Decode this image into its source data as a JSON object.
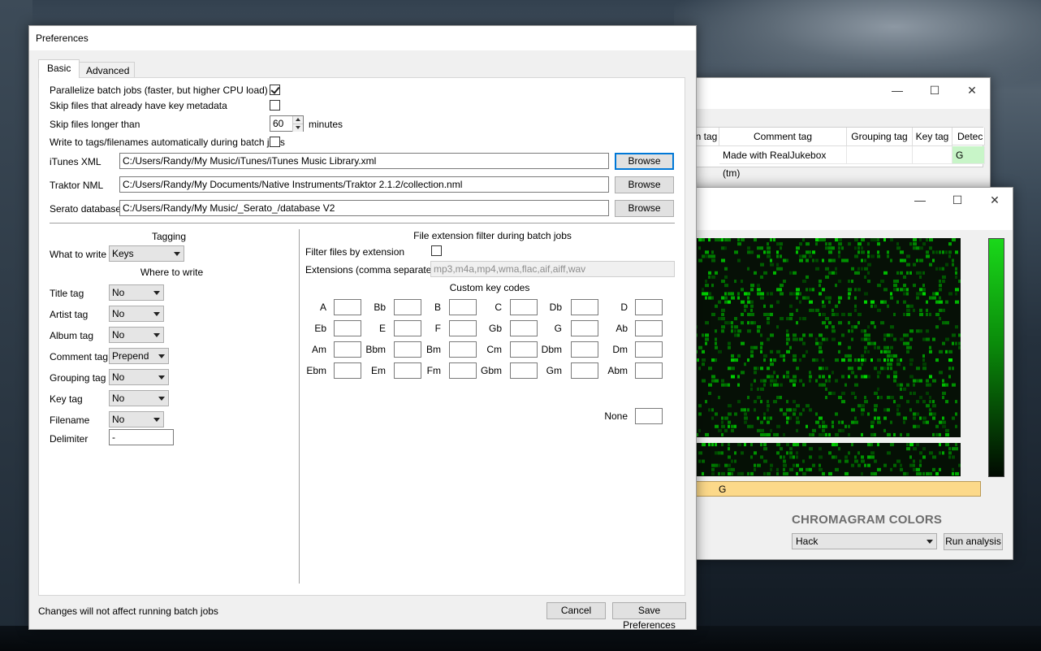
{
  "desktop": {
    "colors": {
      "sky": "#3b4a58",
      "accent": "#0078d7"
    }
  },
  "back_window_1": {
    "columns": [
      "n tag",
      "Comment tag",
      "Grouping tag",
      "Key tag",
      "Detec"
    ],
    "row": {
      "comment": "Made with RealJukebox (tm)",
      "grouping": "",
      "key": "",
      "detected": "G"
    }
  },
  "back_window_2": {
    "key_strip": "G",
    "chromagram_label": "CHROMAGRAM COLORS",
    "color_scheme": "Hack",
    "run_analysis": "Run analysis"
  },
  "prefs": {
    "title": "Preferences",
    "tabs": [
      "Basic",
      "Advanced"
    ],
    "parallelize": {
      "label": "Parallelize batch jobs (faster, but higher CPU load)",
      "checked": true
    },
    "skip_key": {
      "label": "Skip files that already have key metadata",
      "checked": false
    },
    "skip_longer": {
      "label": "Skip files longer than",
      "value": "60",
      "unit": "minutes"
    },
    "write_tags": {
      "label": "Write to tags/filenames automatically during batch jobs",
      "checked": false
    },
    "itunes": {
      "label": "iTunes XML",
      "path": "C:/Users/Randy/My Music/iTunes/iTunes Music Library.xml",
      "button": "Browse"
    },
    "traktor": {
      "label": "Traktor NML",
      "path": "C:/Users/Randy/My Documents/Native Instruments/Traktor 2.1.2/collection.nml",
      "button": "Browse"
    },
    "serato": {
      "label": "Serato database",
      "path": "C:/Users/Randy/My Music/_Serato_/database V2",
      "button": "Browse"
    },
    "tagging": {
      "heading": "Tagging",
      "what_label": "What to write",
      "what_value": "Keys",
      "where_heading": "Where to write",
      "fields": [
        {
          "label": "Title tag",
          "value": "No"
        },
        {
          "label": "Artist tag",
          "value": "No"
        },
        {
          "label": "Album tag",
          "value": "No"
        },
        {
          "label": "Comment tag",
          "value": "Prepend"
        },
        {
          "label": "Grouping tag",
          "value": "No"
        },
        {
          "label": "Key tag",
          "value": "No"
        },
        {
          "label": "Filename",
          "value": "No"
        }
      ],
      "delimiter_label": "Delimiter",
      "delimiter_value": "-"
    },
    "filter": {
      "heading": "File extension filter during batch jobs",
      "by_ext_label": "Filter files by extension",
      "ext_label": "Extensions (comma separated)",
      "ext_value": "mp3,m4a,mp4,wma,flac,aif,aiff,wav"
    },
    "custom_keys": {
      "heading": "Custom key codes",
      "rows": [
        [
          "A",
          "Bb",
          "B",
          "C",
          "Db",
          "D"
        ],
        [
          "Eb",
          "E",
          "F",
          "Gb",
          "G",
          "Ab"
        ],
        [
          "Am",
          "Bbm",
          "Bm",
          "Cm",
          "Dbm",
          "Dm"
        ],
        [
          "Ebm",
          "Em",
          "Fm",
          "Gbm",
          "Gm",
          "Abm"
        ]
      ],
      "none_label": "None"
    },
    "footer_note": "Changes will not affect running batch jobs",
    "cancel": "Cancel",
    "save": "Save Preferences"
  }
}
